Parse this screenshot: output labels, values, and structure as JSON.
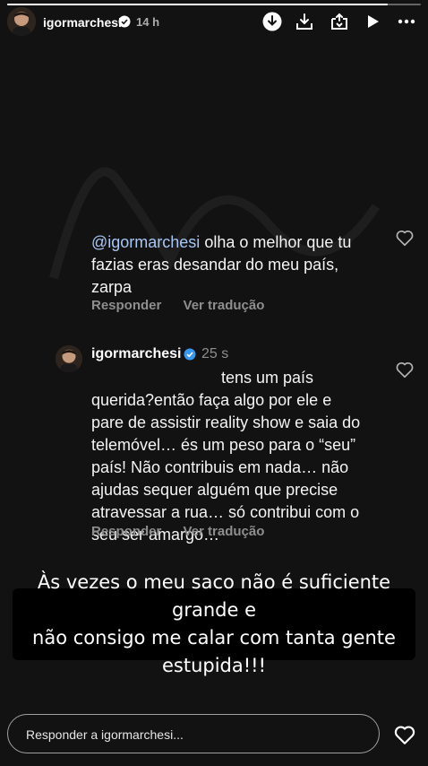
{
  "progress": {
    "fraction": 0.92
  },
  "header": {
    "username": "igormarchesi",
    "time": "14 h"
  },
  "comments": [
    {
      "mention": "@igormarchesi",
      "lines": [
        "olha  o melhor que tu",
        "fazias eras  desandar do meu país,",
        "zarpa"
      ],
      "reply_label": "Responder",
      "translate_label": "Ver tradução"
    },
    {
      "username": "igormarchesi",
      "time": "25 s",
      "lines": [
        "tens um país",
        "querida?então faça algo por ele e",
        "pare de assistir reality show e saia do",
        "telemóvel… és um peso para o “seu”",
        "país! Não contribuis em nada… não",
        "ajudas sequer alguém que precise",
        "atravessar a rua… só contribui com o",
        "seu ser amargo…"
      ],
      "reply_label": "Responder",
      "translate_label": "Ver tradução"
    }
  ],
  "caption": {
    "line1": "Às vezes o meu saco não é suficiente grande  e",
    "line2": "não consigo me calar com tanta gente estupida!!!"
  },
  "reply_bar": {
    "placeholder": "Responder a igormarchesi..."
  },
  "icons": {
    "verified_color": "#3897f0"
  }
}
